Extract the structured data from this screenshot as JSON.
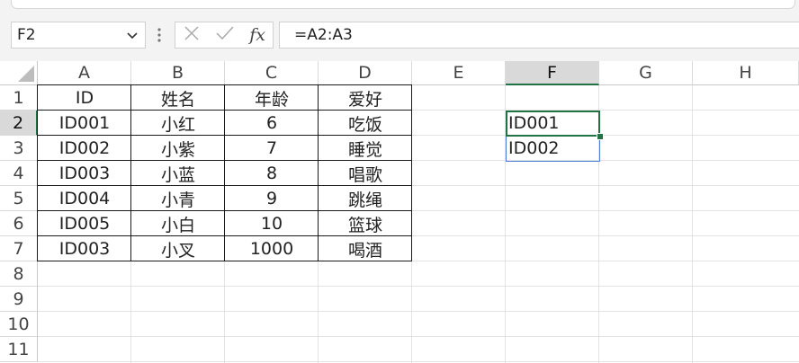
{
  "name_box": {
    "value": "F2"
  },
  "formula_bar": {
    "formula": "=A2:A3"
  },
  "columns": [
    "A",
    "B",
    "C",
    "D",
    "E",
    "F",
    "G",
    "H"
  ],
  "rows": [
    "1",
    "2",
    "3",
    "4",
    "5",
    "6",
    "7",
    "8",
    "9",
    "10",
    "11"
  ],
  "selected": {
    "column": "F",
    "row": "2"
  },
  "table": {
    "header": [
      "ID",
      "姓名",
      "年龄",
      "爱好"
    ],
    "rows": [
      [
        "ID001",
        "小红",
        "6",
        "吃饭"
      ],
      [
        "ID002",
        "小紫",
        "7",
        "睡觉"
      ],
      [
        "ID003",
        "小蓝",
        "8",
        "唱歌"
      ],
      [
        "ID004",
        "小青",
        "9",
        "跳绳"
      ],
      [
        "ID005",
        "小白",
        "10",
        "篮球"
      ],
      [
        "ID003",
        "小叉",
        "1000",
        "喝酒"
      ]
    ]
  },
  "spill_values": [
    "ID001",
    "ID002"
  ],
  "colors": {
    "selection": "#217346",
    "spill_border": "#4a7fd4",
    "header_selected_bg": "#d9d9d9"
  }
}
